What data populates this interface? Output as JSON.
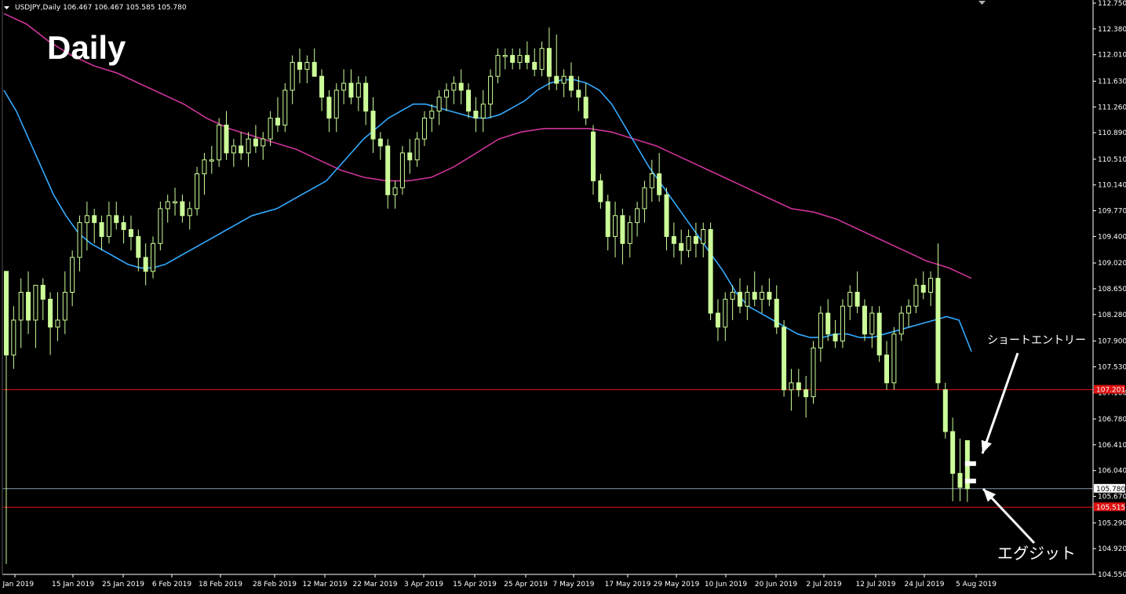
{
  "header": {
    "symbol_info": "USDJPY,Daily 106.467 106.467 105.585 105.780",
    "dropdown_icon": "triangle-down-icon"
  },
  "title": "Daily",
  "annotations": {
    "entry_label": "ショートエントリー",
    "exit_label": "エグジット"
  },
  "price_tags": {
    "current": "105.780",
    "upper_line": "107.201",
    "lower_line": "105.515"
  },
  "colors": {
    "background": "#000000",
    "candle": "#ccff99",
    "ma_short": "#33aaff",
    "ma_long": "#cc3399",
    "level_line": "#dd1111",
    "current_line": "#8899aa",
    "axis": "#ffffff"
  },
  "chart_data": {
    "type": "candlestick",
    "symbol": "USDJPY",
    "timeframe": "Daily",
    "ylim": [
      104.55,
      112.75
    ],
    "y_ticks": [
      "112.750",
      "112.380",
      "112.010",
      "111.630",
      "111.260",
      "110.890",
      "110.510",
      "110.140",
      "109.770",
      "109.400",
      "109.020",
      "108.650",
      "108.280",
      "107.900",
      "107.530",
      "107.160",
      "106.780",
      "106.410",
      "106.040",
      "105.670",
      "105.290",
      "104.920",
      "104.550"
    ],
    "x_ticks": [
      "3 Jan 2019",
      "15 Jan 2019",
      "25 Jan 2019",
      "6 Feb 2019",
      "18 Feb 2019",
      "28 Feb 2019",
      "12 Mar 2019",
      "22 Mar 2019",
      "3 Apr 2019",
      "15 Apr 2019",
      "25 Apr 2019",
      "7 May 2019",
      "17 May 2019",
      "29 May 2019",
      "10 Jun 2019",
      "20 Jun 2019",
      "2 Jul 2019",
      "12 Jul 2019",
      "24 Jul 2019",
      "5 Aug 2019"
    ],
    "horizontal_lines": [
      {
        "price": 107.201,
        "label": "107.201"
      },
      {
        "price": 105.515,
        "label": "105.515"
      },
      {
        "price": 105.78,
        "label": "105.780"
      }
    ],
    "trades": [
      {
        "type": "short_entry",
        "price": 106.14,
        "label": "ショートエントリー"
      },
      {
        "type": "exit",
        "price": 105.89,
        "label": "エグジット"
      }
    ],
    "ohlc": [
      [
        108.9,
        108.9,
        104.7,
        107.7
      ],
      [
        107.7,
        108.4,
        107.5,
        108.2
      ],
      [
        108.2,
        108.8,
        107.8,
        108.6
      ],
      [
        108.6,
        108.9,
        108.0,
        108.2
      ],
      [
        108.2,
        108.7,
        107.8,
        108.7
      ],
      [
        108.7,
        108.8,
        108.2,
        108.5
      ],
      [
        108.5,
        108.6,
        107.7,
        108.1
      ],
      [
        108.1,
        108.6,
        107.9,
        108.2
      ],
      [
        108.2,
        108.9,
        108.0,
        108.6
      ],
      [
        108.6,
        109.2,
        108.4,
        109.1
      ],
      [
        109.1,
        109.7,
        108.9,
        109.6
      ],
      [
        109.6,
        109.9,
        109.2,
        109.7
      ],
      [
        109.7,
        109.8,
        109.3,
        109.6
      ],
      [
        109.6,
        109.7,
        109.2,
        109.4
      ],
      [
        109.4,
        109.9,
        109.3,
        109.7
      ],
      [
        109.7,
        109.9,
        109.5,
        109.6
      ],
      [
        109.6,
        109.7,
        109.3,
        109.5
      ],
      [
        109.5,
        109.7,
        109.2,
        109.4
      ],
      [
        109.4,
        109.5,
        108.9,
        109.1
      ],
      [
        109.1,
        109.3,
        108.7,
        108.9
      ],
      [
        108.9,
        109.4,
        108.8,
        109.3
      ],
      [
        109.3,
        109.9,
        109.2,
        109.8
      ],
      [
        109.8,
        110.0,
        109.6,
        109.9
      ],
      [
        109.9,
        110.1,
        109.7,
        109.9
      ],
      [
        109.9,
        110.0,
        109.6,
        109.7
      ],
      [
        109.7,
        109.9,
        109.5,
        109.8
      ],
      [
        109.8,
        110.4,
        109.7,
        110.3
      ],
      [
        110.3,
        110.6,
        110.0,
        110.5
      ],
      [
        110.5,
        110.7,
        110.3,
        110.5
      ],
      [
        110.5,
        111.1,
        110.4,
        111.0
      ],
      [
        111.0,
        111.2,
        110.5,
        110.6
      ],
      [
        110.6,
        110.8,
        110.4,
        110.7
      ],
      [
        110.7,
        110.9,
        110.5,
        110.6
      ],
      [
        110.6,
        110.9,
        110.4,
        110.8
      ],
      [
        110.8,
        111.0,
        110.6,
        110.7
      ],
      [
        110.7,
        110.9,
        110.5,
        110.8
      ],
      [
        110.8,
        111.2,
        110.7,
        111.1
      ],
      [
        111.1,
        111.4,
        110.9,
        111.0
      ],
      [
        111.0,
        111.6,
        110.9,
        111.5
      ],
      [
        111.5,
        112.0,
        111.3,
        111.9
      ],
      [
        111.9,
        112.1,
        111.6,
        111.8
      ],
      [
        111.8,
        112.0,
        111.6,
        111.9
      ],
      [
        111.9,
        112.1,
        111.7,
        111.7
      ],
      [
        111.7,
        111.8,
        111.2,
        111.4
      ],
      [
        111.4,
        111.5,
        110.9,
        111.1
      ],
      [
        111.1,
        111.6,
        110.9,
        111.5
      ],
      [
        111.5,
        111.8,
        111.3,
        111.6
      ],
      [
        111.6,
        111.8,
        111.3,
        111.4
      ],
      [
        111.4,
        111.7,
        111.2,
        111.6
      ],
      [
        111.6,
        111.7,
        111.0,
        111.2
      ],
      [
        111.2,
        111.4,
        110.6,
        110.8
      ],
      [
        110.8,
        110.9,
        110.5,
        110.7
      ],
      [
        110.7,
        110.8,
        109.8,
        110.0
      ],
      [
        110.0,
        110.2,
        109.8,
        110.1
      ],
      [
        110.1,
        110.7,
        110.0,
        110.6
      ],
      [
        110.6,
        110.8,
        110.3,
        110.5
      ],
      [
        110.5,
        110.9,
        110.4,
        110.8
      ],
      [
        110.8,
        111.2,
        110.7,
        111.1
      ],
      [
        111.1,
        111.3,
        110.9,
        111.2
      ],
      [
        111.2,
        111.5,
        111.0,
        111.4
      ],
      [
        111.4,
        111.6,
        111.2,
        111.5
      ],
      [
        111.5,
        111.7,
        111.3,
        111.6
      ],
      [
        111.6,
        111.8,
        111.3,
        111.5
      ],
      [
        111.5,
        111.6,
        111.1,
        111.2
      ],
      [
        111.2,
        111.4,
        110.9,
        111.1
      ],
      [
        111.1,
        111.5,
        110.9,
        111.3
      ],
      [
        111.3,
        111.8,
        111.1,
        111.7
      ],
      [
        111.7,
        112.1,
        111.6,
        112.0
      ],
      [
        112.0,
        112.1,
        111.8,
        112.0
      ],
      [
        112.0,
        112.1,
        111.8,
        111.9
      ],
      [
        111.9,
        112.1,
        111.8,
        112.0
      ],
      [
        112.0,
        112.2,
        111.8,
        111.9
      ],
      [
        111.9,
        112.1,
        111.7,
        111.8
      ],
      [
        111.8,
        112.2,
        111.7,
        112.1
      ],
      [
        112.1,
        112.4,
        111.5,
        111.7
      ],
      [
        111.7,
        112.3,
        111.5,
        111.6
      ],
      [
        111.6,
        111.8,
        111.4,
        111.7
      ],
      [
        111.7,
        111.9,
        111.4,
        111.5
      ],
      [
        111.5,
        111.7,
        111.2,
        111.4
      ],
      [
        111.4,
        111.6,
        111.0,
        111.1
      ],
      [
        110.9,
        111.0,
        110.0,
        110.2
      ],
      [
        110.2,
        110.3,
        109.8,
        109.9
      ],
      [
        109.9,
        110.0,
        109.2,
        109.4
      ],
      [
        109.4,
        109.9,
        109.1,
        109.7
      ],
      [
        109.7,
        109.8,
        109.0,
        109.3
      ],
      [
        109.3,
        109.7,
        109.1,
        109.6
      ],
      [
        109.6,
        109.9,
        109.4,
        109.8
      ],
      [
        109.8,
        110.2,
        109.6,
        110.1
      ],
      [
        110.1,
        110.5,
        109.9,
        110.3
      ],
      [
        110.3,
        110.6,
        109.9,
        110.0
      ],
      [
        110.0,
        110.1,
        109.2,
        109.4
      ],
      [
        109.4,
        109.6,
        109.1,
        109.3
      ],
      [
        109.3,
        109.5,
        109.0,
        109.2
      ],
      [
        109.2,
        109.5,
        109.1,
        109.4
      ],
      [
        109.4,
        109.6,
        109.1,
        109.3
      ],
      [
        109.3,
        109.6,
        109.1,
        109.5
      ],
      [
        109.5,
        109.6,
        108.2,
        108.3
      ],
      [
        108.3,
        108.5,
        107.9,
        108.1
      ],
      [
        108.1,
        108.6,
        107.9,
        108.5
      ],
      [
        108.5,
        108.7,
        108.2,
        108.6
      ],
      [
        108.6,
        108.8,
        108.3,
        108.4
      ],
      [
        108.4,
        108.7,
        108.2,
        108.6
      ],
      [
        108.6,
        108.9,
        108.4,
        108.5
      ],
      [
        108.5,
        108.7,
        108.3,
        108.6
      ],
      [
        108.6,
        108.8,
        108.4,
        108.5
      ],
      [
        108.5,
        108.7,
        108.0,
        108.1
      ],
      [
        108.1,
        108.2,
        107.1,
        107.2
      ],
      [
        107.2,
        107.5,
        106.9,
        107.3
      ],
      [
        107.3,
        107.5,
        107.1,
        107.2
      ],
      [
        107.2,
        107.4,
        106.8,
        107.1
      ],
      [
        107.1,
        107.9,
        107.0,
        107.8
      ],
      [
        107.8,
        108.4,
        107.6,
        108.3
      ],
      [
        108.3,
        108.5,
        107.9,
        108.0
      ],
      [
        108.0,
        108.2,
        107.8,
        107.9
      ],
      [
        107.9,
        108.5,
        107.8,
        108.4
      ],
      [
        108.4,
        108.7,
        108.2,
        108.6
      ],
      [
        108.6,
        108.9,
        108.3,
        108.4
      ],
      [
        108.4,
        108.5,
        107.9,
        108.0
      ],
      [
        108.0,
        108.4,
        107.8,
        108.3
      ],
      [
        108.3,
        108.4,
        107.6,
        107.7
      ],
      [
        107.7,
        107.9,
        107.2,
        107.3
      ],
      [
        107.3,
        108.1,
        107.2,
        108.0
      ],
      [
        108.0,
        108.4,
        107.9,
        108.3
      ],
      [
        108.3,
        108.5,
        108.1,
        108.4
      ],
      [
        108.4,
        108.8,
        108.3,
        108.7
      ],
      [
        108.7,
        108.9,
        108.5,
        108.6
      ],
      [
        108.6,
        108.9,
        108.4,
        108.8
      ],
      [
        108.8,
        109.3,
        107.2,
        107.3
      ],
      [
        107.2,
        107.3,
        106.5,
        106.6
      ],
      [
        106.6,
        106.8,
        105.6,
        106.0
      ],
      [
        106.0,
        106.5,
        105.6,
        105.8
      ],
      [
        106.47,
        106.47,
        105.59,
        105.78
      ]
    ],
    "ma_short": {
      "name": "",
      "values": [
        111.5,
        111.2,
        110.8,
        110.4,
        110.0,
        109.7,
        109.45,
        109.3,
        109.2,
        109.1,
        109.0,
        108.95,
        108.95,
        109.0,
        109.1,
        109.2,
        109.3,
        109.4,
        109.5,
        109.6,
        109.7,
        109.75,
        109.8,
        109.9,
        110.0,
        110.1,
        110.2,
        110.4,
        110.6,
        110.8,
        110.95,
        111.1,
        111.2,
        111.3,
        111.3,
        111.25,
        111.2,
        111.15,
        111.1,
        111.1,
        111.15,
        111.25,
        111.35,
        111.5,
        111.6,
        111.65,
        111.65,
        111.6,
        111.5,
        111.3,
        111.0,
        110.7,
        110.4,
        110.15,
        109.9,
        109.65,
        109.4,
        109.15,
        108.9,
        108.6,
        108.4,
        108.3,
        108.2,
        108.1,
        108.0,
        107.95,
        107.95,
        108.0,
        108.0,
        107.95,
        107.95,
        108.0,
        108.05,
        108.1,
        108.15,
        108.2,
        108.25,
        108.2,
        107.75
      ]
    },
    "ma_long": {
      "name": "",
      "values": [
        112.6,
        112.45,
        112.2,
        112.0,
        111.85,
        111.75,
        111.6,
        111.45,
        111.3,
        111.1,
        110.95,
        110.85,
        110.75,
        110.65,
        110.5,
        110.35,
        110.25,
        110.2,
        110.2,
        110.25,
        110.4,
        110.6,
        110.8,
        110.9,
        110.95,
        110.95,
        110.95,
        110.9,
        110.8,
        110.7,
        110.55,
        110.4,
        110.25,
        110.1,
        109.95,
        109.8,
        109.75,
        109.65,
        109.5,
        109.35,
        109.2,
        109.05,
        108.95,
        108.8
      ]
    }
  }
}
